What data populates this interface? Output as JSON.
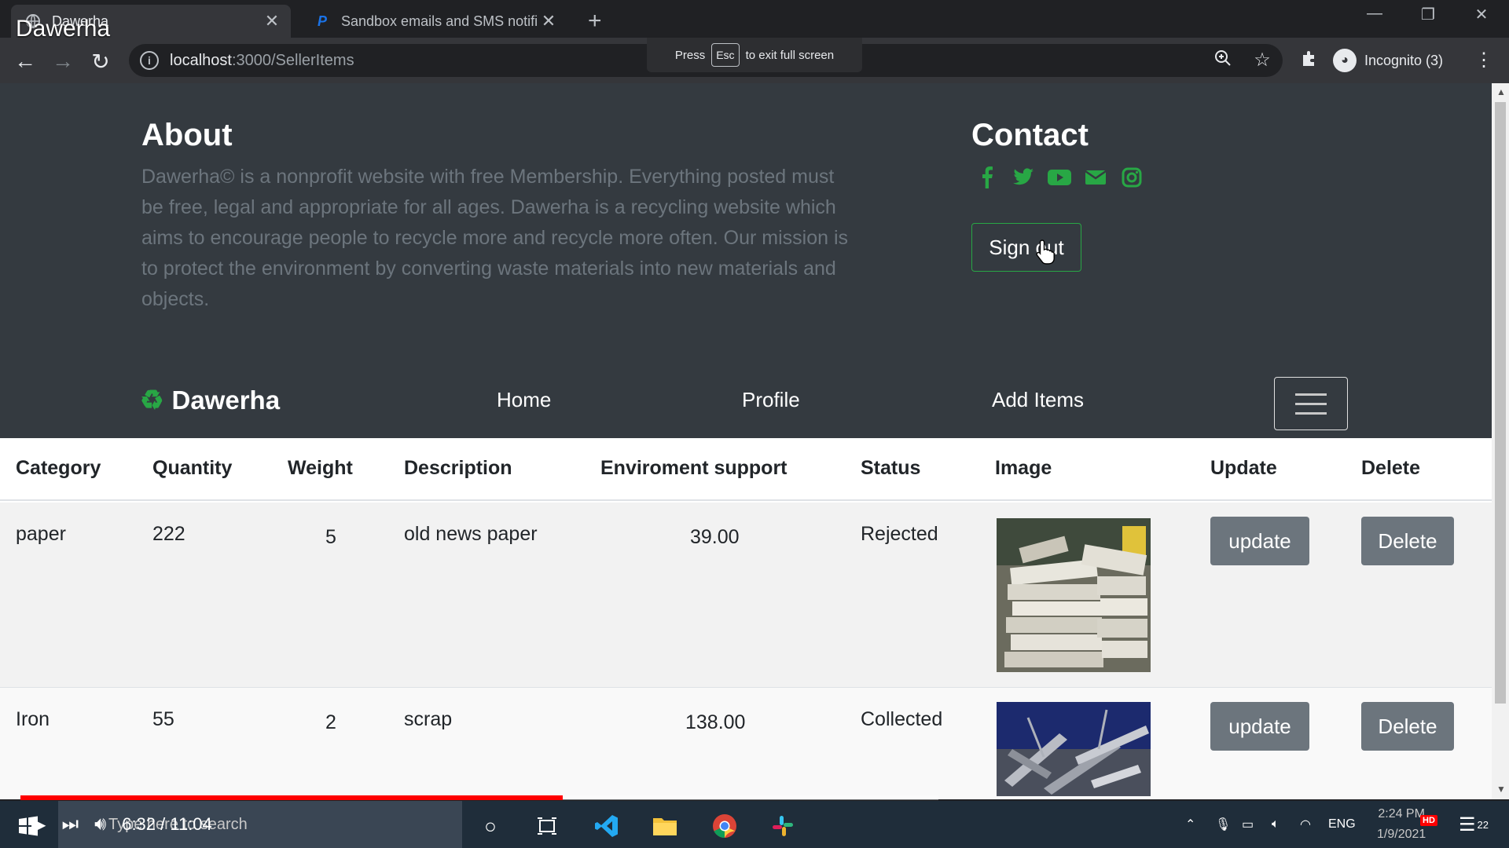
{
  "video_title": "Dawerha",
  "tabs": [
    {
      "title": "Dawerha",
      "active": true
    },
    {
      "title": "Sandbox emails and SMS notifica",
      "active": false
    }
  ],
  "toolbar": {
    "url_host": "localhost",
    "url_path": ":3000/SellerItems",
    "fullscreen_hint_pre": "Press",
    "fullscreen_hint_key": "Esc",
    "fullscreen_hint_post": "to exit full screen",
    "profile_label": "Incognito (3)"
  },
  "footer": {
    "about_title": "About",
    "about_text": "Dawerha© is a nonprofit website with free Membership. Everything posted must be free, legal and appropriate for all ages. Dawerha is a recycling website which aims to encourage people to recycle more and recycle more often. Our mission is to protect the environment by converting waste materials into new materials and objects.",
    "contact_title": "Contact",
    "socials": [
      "facebook-icon",
      "twitter-icon",
      "youtube-icon",
      "envelope-icon",
      "instagram-icon"
    ],
    "sign_out_label": "Sign out"
  },
  "navbar": {
    "brand": "Dawerha",
    "links": [
      "Home",
      "Profile",
      "Add Items"
    ]
  },
  "table": {
    "headers": [
      "Category",
      "Quantity",
      "Weight",
      "Description",
      "Enviroment support",
      "Status",
      "Image",
      "Update",
      "Delete"
    ],
    "rows": [
      {
        "category": "paper",
        "quantity": "222",
        "weight": "5",
        "description": "old news paper",
        "support": "39.00",
        "status": "Rejected",
        "update_label": "update",
        "delete_label": "Delete"
      },
      {
        "category": "Iron",
        "quantity": "55",
        "weight": "2",
        "description": "scrap",
        "support": "138.00",
        "status": "Collected",
        "update_label": "update",
        "delete_label": "Delete"
      }
    ]
  },
  "video": {
    "time": "6:32 / 11:04",
    "progress_fraction": 0.591
  },
  "taskbar": {
    "search_placeholder": "Type here to search",
    "lang": "ENG",
    "time": "2:24 PM",
    "date": "1/9/2021",
    "notification_count": "22",
    "hd_badge": "HD"
  },
  "colors": {
    "accent_green": "#28a745",
    "dark_bg": "#343a40",
    "gray_button": "#6c757d"
  }
}
